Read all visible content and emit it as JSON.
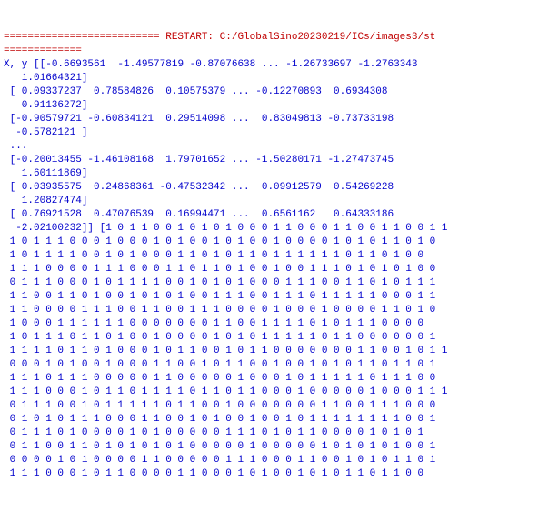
{
  "restart_prefix": "========================== RESTART: ",
  "restart_path": "C:/GlobalSino20230219/ICs/images3/st",
  "separator": "=============",
  "prompt": "X, y ",
  "arrays": [
    "[[-0.6693561  -1.49577819 -0.87076638 ... -1.26733697 -1.2763343",
    "   1.01664321]",
    " [ 0.09337237  0.78584826  0.10575379 ... -0.12270893  0.6934308",
    "   0.91136272]",
    " [-0.90579721 -0.60834121  0.29514098 ...  0.83049813 -0.73733198",
    "  -0.5782121 ]",
    " ...",
    " [-0.20013455 -1.46108168  1.79701652 ... -1.50280171 -1.27473745",
    "   1.60111869]",
    " [ 0.03935575  0.24868361 -0.47532342 ...  0.09912579  0.54269228",
    "   1.20827474]",
    " [ 0.76921528  0.47076539  0.16994471 ...  0.6561162   0.64333186",
    "  -2.02100232]] "
  ],
  "bin_first": "[1 0 1 1 0 0 1 0 1 0 1 0 0 0 1 1 0 0 0 1 1 0 0 1 1 0 0 1 1",
  "bin_rows": [
    " 1 0 1 1 1 0 0 0 1 0 0 0 1 0 1 0 0 1 0 1 0 0 1 0 0 0 0 1 0 1 0 1 1 0 1 0",
    " 1 0 1 1 1 1 0 0 1 0 1 0 0 0 1 1 0 1 0 1 1 0 1 1 1 1 1 1 0 1 1 0 1 0 0",
    " 1 1 1 0 0 0 0 1 1 1 0 0 0 1 1 0 1 1 0 1 0 0 1 0 0 1 1 1 0 1 0 1 0 1 0 0",
    " 0 1 1 1 0 0 0 1 0 1 1 1 1 0 0 1 0 1 0 1 0 0 0 1 1 1 0 0 1 1 0 1 0 1 1 1",
    " 1 1 0 0 1 1 0 1 0 0 1 0 1 0 1 0 0 1 1 1 0 0 1 1 1 0 1 1 1 1 1 0 0 0 1 1",
    " 1 1 0 0 0 0 1 1 1 0 0 1 1 0 0 1 1 1 0 0 0 0 1 0 0 0 1 0 0 0 0 1 1 0 1 0",
    " 1 0 0 0 1 1 1 1 1 1 0 0 0 0 0 0 0 1 1 0 0 1 1 1 1 0 1 0 1 1 1 0 0 0 0",
    " 1 0 1 1 1 0 1 1 0 1 0 0 1 0 0 0 0 1 0 1 0 1 1 1 1 1 0 1 1 0 0 0 0 0 0 1",
    " 1 1 1 1 0 1 1 0 1 0 0 0 1 0 1 1 0 0 1 0 1 1 0 0 0 0 0 0 0 1 1 0 0 1 0 1 1",
    " 0 0 0 1 0 1 0 0 1 0 0 0 1 1 0 0 1 0 1 1 0 0 1 0 0 1 0 1 0 1 1 0 1 1 0 1",
    " 1 1 1 0 1 1 1 0 0 0 0 0 1 1 0 0 0 0 0 1 0 0 0 1 0 1 1 1 1 1 0 1 1 1 0 0",
    " 1 1 1 0 0 0 1 0 1 1 0 1 1 1 1 0 1 1 0 1 1 0 0 0 1 0 0 0 0 0 1 0 0 0 1 1 1",
    " 0 1 1 1 0 0 1 0 1 1 1 1 1 0 1 1 0 0 1 0 0 0 0 0 0 0 1 1 0 0 1 1 1 0 0 0",
    " 0 1 0 1 0 1 1 1 0 0 0 1 1 0 0 1 0 1 0 0 1 0 0 1 0 1 1 1 1 1 1 1 1 0 0 1",
    " 0 1 1 1 0 1 0 0 0 0 1 0 1 0 0 0 0 0 1 1 1 0 1 0 1 1 0 0 0 0 1 0 1 0 1",
    " 0 1 1 0 0 1 1 0 1 0 1 0 1 0 1 0 0 0 0 0 1 0 0 0 0 0 1 0 1 0 1 0 1 0 0 1",
    " 0 0 0 0 1 0 1 0 0 0 0 1 1 0 0 0 0 0 1 1 1 0 0 0 1 1 0 0 1 0 1 0 1 1 0 1",
    " 1 1 1 0 0 0 1 0 1 1 0 0 0 0 1 1 0 0 0 1 0 1 0 0 1 0 1 0 1 1 0 1 1 0 0"
  ]
}
